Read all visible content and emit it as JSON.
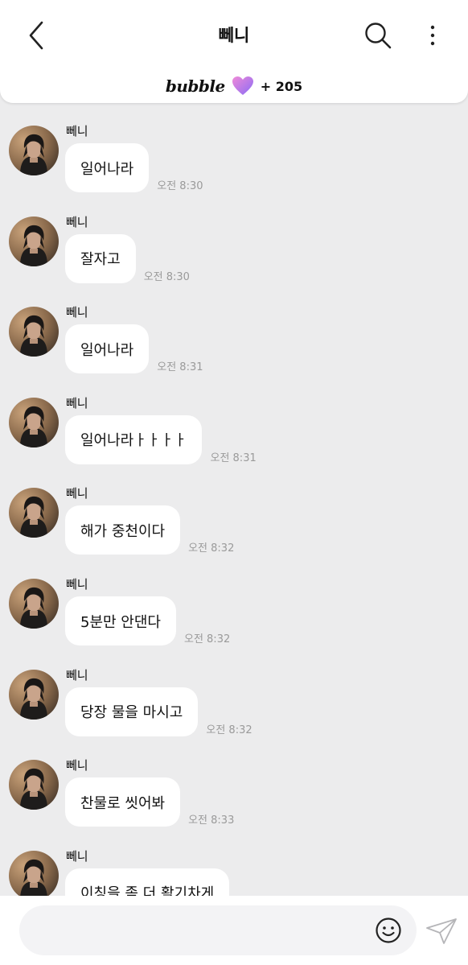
{
  "header": {
    "title": "뻬니",
    "brand": "bubble",
    "subscribers": "+ 205"
  },
  "messages": [
    {
      "sender": "뻬니",
      "text": "일어나라",
      "time": "오전 8:30"
    },
    {
      "sender": "뻬니",
      "text": "잘자고",
      "time": "오전 8:30"
    },
    {
      "sender": "뻬니",
      "text": "일어나라",
      "time": "오전 8:31"
    },
    {
      "sender": "뻬니",
      "text": "일어나라ㅏㅏㅏㅏ",
      "time": "오전 8:31"
    },
    {
      "sender": "뻬니",
      "text": "해가 중천이다",
      "time": "오전 8:32"
    },
    {
      "sender": "뻬니",
      "text": "5분만 안댄다",
      "time": "오전 8:32"
    },
    {
      "sender": "뻬니",
      "text": "당장 물을 마시고",
      "time": "오전 8:32"
    },
    {
      "sender": "뻬니",
      "text": "찬물로 씻어봐",
      "time": "오전 8:33"
    },
    {
      "sender": "뻬니",
      "text": "이칭을 좀 더 활기차게",
      "time": ""
    }
  ],
  "input": {
    "placeholder": "",
    "value": ""
  },
  "icons": {
    "back": "chevron-left-icon",
    "search": "search-icon",
    "more": "more-vertical-icon",
    "heart": "heart-icon",
    "emoji": "smile-icon",
    "send": "paper-plane-icon"
  },
  "colors": {
    "background": "#ececed",
    "bubble": "#ffffff",
    "heart_from": "#f08ad8",
    "heart_to": "#8a6cf5",
    "timestamp": "#9a9a9a"
  }
}
